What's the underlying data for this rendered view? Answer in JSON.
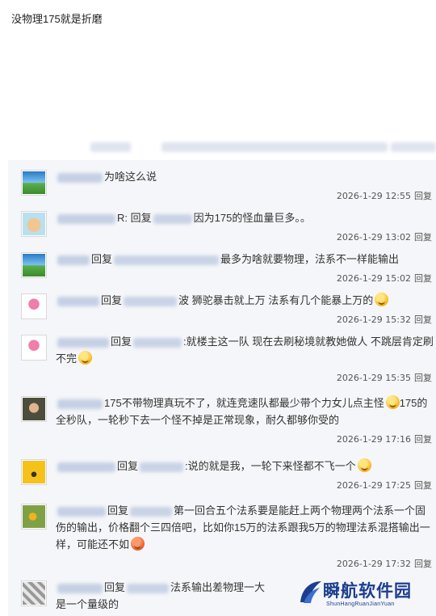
{
  "post": {
    "text": "没物理175就是折磨"
  },
  "reply_label": "回复",
  "comments": [
    {
      "text": "为啥这么说",
      "prefix": "",
      "timestamp": "2026-1-29 12:55"
    },
    {
      "prefix": "R: 回复",
      "text": "因为175的怪血量巨多。。",
      "timestamp": "2026-1-29 13:02"
    },
    {
      "prefix": "回复",
      "text": "最多为啥就要物理，法系不一样能输出",
      "timestamp": "2026-1-29 15:02"
    },
    {
      "prefix": "回复",
      "text": "波 狮驼暴击就上万 法系有几个能暴上万的",
      "timestamp": "2026-1-29 15:32"
    },
    {
      "prefix": "回复",
      "text": ":就楼主这一队 现在去刷秘境就教她做人 不跳层肯定刷不完",
      "timestamp": "2026-1-29 15:35"
    },
    {
      "prefix": "",
      "text": "175不带物理真玩不了，就连竞速队都最少带个力女儿点主怪",
      "text2": "175的全秒队，一轮秒下去一个怪不掉是正常现象，耐久都够你受的",
      "timestamp": "2026-1-29 17:16"
    },
    {
      "prefix": "回复",
      "text": ":说的就是我，一轮下来怪都不飞一个",
      "timestamp": "2026-1-29 17:25"
    },
    {
      "prefix": "回复",
      "text": "第一回合五个法系要是能赶上两个物理两个法系一个固伤的输出，价格翻个三四倍吧，比如你15万的法系跟我5万的物理法系混搭输出一样，可能还不如",
      "timestamp": "2026-1-29 17:32"
    },
    {
      "prefix": "回复",
      "text": "法系输出差物理一大",
      "text2": "是一个量级的",
      "timestamp": ""
    }
  ],
  "watermark": {
    "title": "瞬航软件园",
    "subtitle": "ShunHangRuanJianYuan"
  },
  "colors": {
    "panel_bg": "#f5f6f9",
    "watermark": "#1d3e8f"
  },
  "icons": [
    "emoji-smile-icon",
    "emoji-grin-icon",
    "emoji-angry-icon"
  ]
}
